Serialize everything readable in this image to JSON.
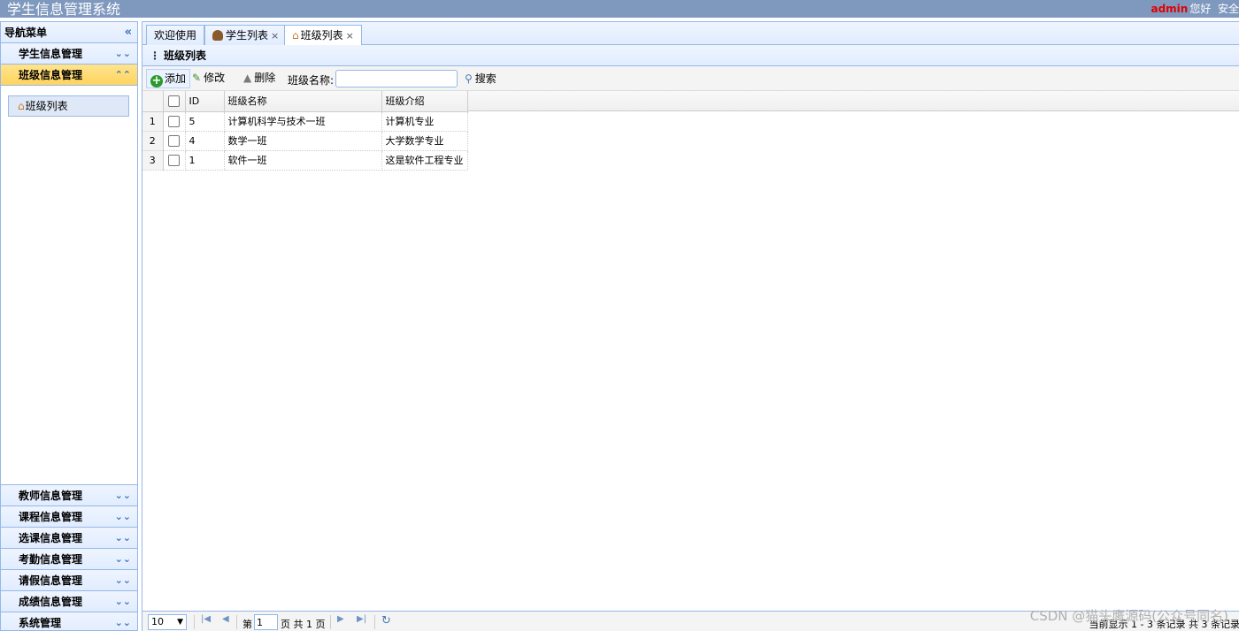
{
  "app": {
    "title": "学生信息管理系统",
    "user_name": "admin",
    "greeting": "您好",
    "extra": "安全"
  },
  "sidebar": {
    "title": "导航菜单",
    "groups": [
      {
        "label": "学生信息管理"
      },
      {
        "label": "班级信息管理"
      },
      {
        "label": "教师信息管理"
      },
      {
        "label": "课程信息管理"
      },
      {
        "label": "选课信息管理"
      },
      {
        "label": "考勤信息管理"
      },
      {
        "label": "请假信息管理"
      },
      {
        "label": "成绩信息管理"
      },
      {
        "label": "系统管理"
      }
    ],
    "active_item": "班级列表"
  },
  "tabs": [
    {
      "label": "欢迎使用"
    },
    {
      "label": "学生列表"
    },
    {
      "label": "班级列表"
    }
  ],
  "panel": {
    "title": "班级列表"
  },
  "toolbar": {
    "add_label": "添加",
    "edit_label": "修改",
    "delete_label": "删除",
    "search_label": "班级名称:",
    "search_value": "",
    "search_button": "搜索"
  },
  "table": {
    "headers": {
      "id": "ID",
      "name": "班级名称",
      "desc": "班级介绍"
    },
    "rows": [
      {
        "num": "1",
        "id": "5",
        "name": "计算机科学与技术一班",
        "desc": "计算机专业"
      },
      {
        "num": "2",
        "id": "4",
        "name": "数学一班",
        "desc": "大学数学专业"
      },
      {
        "num": "3",
        "id": "1",
        "name": "软件一班",
        "desc": "这是软件工程专业"
      }
    ]
  },
  "pager": {
    "page_size": "10",
    "page_prefix": "第",
    "page_number": "1",
    "page_suffix": "页 共 1 页",
    "info": "当前显示 1 - 3 条记录 共 3 条记录"
  },
  "watermark": "CSDN @猫头鹰源码(公众号同名)"
}
